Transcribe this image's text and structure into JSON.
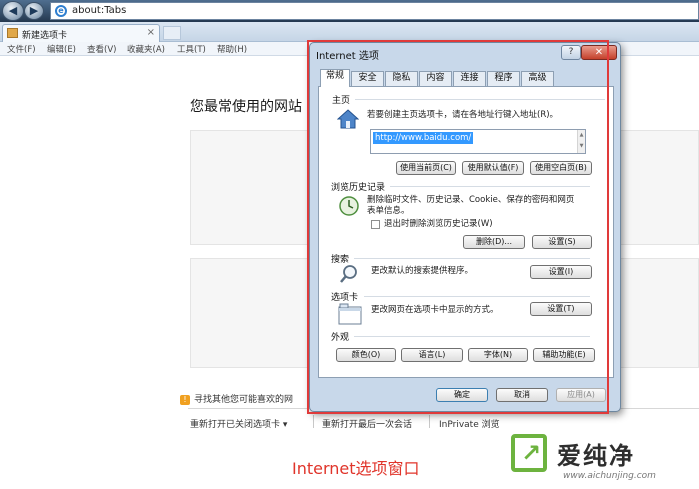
{
  "browser": {
    "address_url": "about:Tabs",
    "tab_title": "新建选项卡",
    "tab_close": "×",
    "back_glyph": "◀",
    "forward_glyph": "▶",
    "menu": [
      "文件(F)",
      "编辑(E)",
      "查看(V)",
      "收藏夹(A)",
      "工具(T)",
      "帮助(H)"
    ]
  },
  "newtab": {
    "heading": "您最常使用的网站",
    "find_text": "寻找其他您可能喜欢的网",
    "links": [
      "重新打开已关闭选项卡 ▾",
      "重新打开最后一次会话",
      "InPrivate 浏览"
    ]
  },
  "dialog": {
    "title": "Internet 选项",
    "help_label": "?",
    "close_label": "✕",
    "tabs": [
      "常规",
      "安全",
      "隐私",
      "内容",
      "连接",
      "程序",
      "高级"
    ],
    "homepage": {
      "title": "主页",
      "description": "若要创建主页选项卡，请在各地址行键入地址(R)。",
      "url_value": "http://www.baidu.com/",
      "buttons": [
        "使用当前页(C)",
        "使用默认值(F)",
        "使用空白页(B)"
      ]
    },
    "history": {
      "title": "浏览历史记录",
      "description_line1": "删除临时文件、历史记录、Cookie、保存的密码和网页",
      "description_line2": "表单信息。",
      "checkbox_label": "退出时删除浏览历史记录(W)",
      "delete_button": "删除(D)...",
      "settings_button": "设置(S)"
    },
    "search": {
      "title": "搜索",
      "description": "更改默认的搜索提供程序。",
      "settings_button": "设置(I)"
    },
    "tabs_section": {
      "title": "选项卡",
      "description": "更改网页在选项卡中显示的方式。",
      "settings_button": "设置(T)"
    },
    "appearance": {
      "title": "外观",
      "buttons": [
        "颜色(O)",
        "语言(L)",
        "字体(N)",
        "辅助功能(E)"
      ]
    },
    "footer": {
      "ok": "确定",
      "cancel": "取消",
      "apply": "应用(A)"
    }
  },
  "annotation": {
    "caption": "Internet选项窗口",
    "watermark_text": "爱纯净",
    "watermark_sub": "www.aichunjing.com",
    "highlight_color": "#e03a3a"
  }
}
